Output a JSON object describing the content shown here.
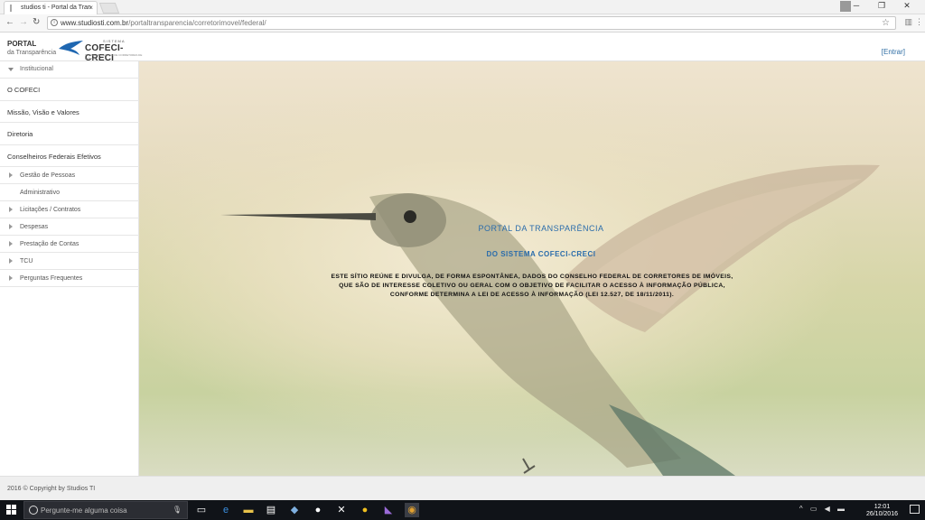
{
  "browser": {
    "tab_title": "studios ti - Portal da Tran",
    "tab_close": "×",
    "url_domain": "www.studiosti.com.br",
    "url_path": "/portaltransparencia/corretorimovel/federal/"
  },
  "header": {
    "portal_title": "PORTAL",
    "portal_subtitle": "da Transparência",
    "logo_system": "SISTEMA",
    "logo_name": "COFECI-CRECI",
    "logo_tagline": "CONSELHO FEDERAL DE CORRETORES DE IMÓVEIS",
    "login_label": "[Entrar]"
  },
  "sidebar": {
    "section_label": "Institucional",
    "items": [
      {
        "label": "O COFECI"
      },
      {
        "label": "Missão, Visão e Valores"
      },
      {
        "label": "Diretoria"
      },
      {
        "label": "Conselheiros Federais Efetivos"
      }
    ],
    "groups": [
      {
        "label": "Gestão de Pessoas",
        "caret": true
      },
      {
        "label": "Administrativo",
        "caret": false
      },
      {
        "label": "Licitações / Contratos",
        "caret": true
      },
      {
        "label": "Despesas",
        "caret": true
      },
      {
        "label": "Prestação de Contas",
        "caret": true
      },
      {
        "label": "TCU",
        "caret": true
      },
      {
        "label": "Perguntas Frequentes",
        "caret": true
      }
    ]
  },
  "hero": {
    "title": "PORTAL DA TRANSPARÊNCIA",
    "subtitle": "DO SISTEMA COFECI-CRECI",
    "text_line1": "ESTE SÍTIO REÚNE E DIVULGA, DE FORMA ESPONTÂNEA, DADOS DO CONSELHO FEDERAL DE CORRETORES DE IMÓVEIS,",
    "text_line2": "QUE SÃO DE INTERESSE COLETIVO OU GERAL COM O OBJETIVO DE FACILITAR O ACESSO À INFORMAÇÃO PÚBLICA,",
    "text_line3": "CONFORME DETERMINA A LEI DE ACESSO À INFORMAÇÃO (LEI 12.527, DE 18/11/2011)."
  },
  "footer": {
    "copyright": "2016 © Copyright by Studios TI"
  },
  "taskbar": {
    "search_placeholder": "Pergunte-me alguma coisa",
    "time": "12:01",
    "date": "26/10/2016"
  },
  "colors": {
    "link_blue": "#2a6cab",
    "taskbar_bg": "#101318"
  }
}
